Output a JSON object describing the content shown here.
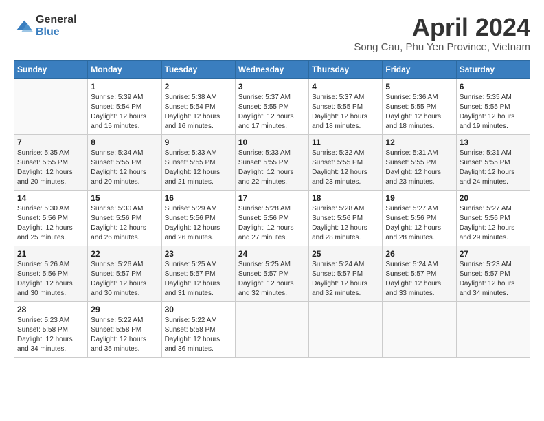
{
  "logo": {
    "general": "General",
    "blue": "Blue"
  },
  "header": {
    "title": "April 2024",
    "subtitle": "Song Cau, Phu Yen Province, Vietnam"
  },
  "calendar": {
    "days_of_week": [
      "Sunday",
      "Monday",
      "Tuesday",
      "Wednesday",
      "Thursday",
      "Friday",
      "Saturday"
    ],
    "weeks": [
      [
        {
          "day": "",
          "info": ""
        },
        {
          "day": "1",
          "info": "Sunrise: 5:39 AM\nSunset: 5:54 PM\nDaylight: 12 hours\nand 15 minutes."
        },
        {
          "day": "2",
          "info": "Sunrise: 5:38 AM\nSunset: 5:54 PM\nDaylight: 12 hours\nand 16 minutes."
        },
        {
          "day": "3",
          "info": "Sunrise: 5:37 AM\nSunset: 5:55 PM\nDaylight: 12 hours\nand 17 minutes."
        },
        {
          "day": "4",
          "info": "Sunrise: 5:37 AM\nSunset: 5:55 PM\nDaylight: 12 hours\nand 18 minutes."
        },
        {
          "day": "5",
          "info": "Sunrise: 5:36 AM\nSunset: 5:55 PM\nDaylight: 12 hours\nand 18 minutes."
        },
        {
          "day": "6",
          "info": "Sunrise: 5:35 AM\nSunset: 5:55 PM\nDaylight: 12 hours\nand 19 minutes."
        }
      ],
      [
        {
          "day": "7",
          "info": "Sunrise: 5:35 AM\nSunset: 5:55 PM\nDaylight: 12 hours\nand 20 minutes."
        },
        {
          "day": "8",
          "info": "Sunrise: 5:34 AM\nSunset: 5:55 PM\nDaylight: 12 hours\nand 20 minutes."
        },
        {
          "day": "9",
          "info": "Sunrise: 5:33 AM\nSunset: 5:55 PM\nDaylight: 12 hours\nand 21 minutes."
        },
        {
          "day": "10",
          "info": "Sunrise: 5:33 AM\nSunset: 5:55 PM\nDaylight: 12 hours\nand 22 minutes."
        },
        {
          "day": "11",
          "info": "Sunrise: 5:32 AM\nSunset: 5:55 PM\nDaylight: 12 hours\nand 23 minutes."
        },
        {
          "day": "12",
          "info": "Sunrise: 5:31 AM\nSunset: 5:55 PM\nDaylight: 12 hours\nand 23 minutes."
        },
        {
          "day": "13",
          "info": "Sunrise: 5:31 AM\nSunset: 5:55 PM\nDaylight: 12 hours\nand 24 minutes."
        }
      ],
      [
        {
          "day": "14",
          "info": "Sunrise: 5:30 AM\nSunset: 5:56 PM\nDaylight: 12 hours\nand 25 minutes."
        },
        {
          "day": "15",
          "info": "Sunrise: 5:30 AM\nSunset: 5:56 PM\nDaylight: 12 hours\nand 26 minutes."
        },
        {
          "day": "16",
          "info": "Sunrise: 5:29 AM\nSunset: 5:56 PM\nDaylight: 12 hours\nand 26 minutes."
        },
        {
          "day": "17",
          "info": "Sunrise: 5:28 AM\nSunset: 5:56 PM\nDaylight: 12 hours\nand 27 minutes."
        },
        {
          "day": "18",
          "info": "Sunrise: 5:28 AM\nSunset: 5:56 PM\nDaylight: 12 hours\nand 28 minutes."
        },
        {
          "day": "19",
          "info": "Sunrise: 5:27 AM\nSunset: 5:56 PM\nDaylight: 12 hours\nand 28 minutes."
        },
        {
          "day": "20",
          "info": "Sunrise: 5:27 AM\nSunset: 5:56 PM\nDaylight: 12 hours\nand 29 minutes."
        }
      ],
      [
        {
          "day": "21",
          "info": "Sunrise: 5:26 AM\nSunset: 5:56 PM\nDaylight: 12 hours\nand 30 minutes."
        },
        {
          "day": "22",
          "info": "Sunrise: 5:26 AM\nSunset: 5:57 PM\nDaylight: 12 hours\nand 30 minutes."
        },
        {
          "day": "23",
          "info": "Sunrise: 5:25 AM\nSunset: 5:57 PM\nDaylight: 12 hours\nand 31 minutes."
        },
        {
          "day": "24",
          "info": "Sunrise: 5:25 AM\nSunset: 5:57 PM\nDaylight: 12 hours\nand 32 minutes."
        },
        {
          "day": "25",
          "info": "Sunrise: 5:24 AM\nSunset: 5:57 PM\nDaylight: 12 hours\nand 32 minutes."
        },
        {
          "day": "26",
          "info": "Sunrise: 5:24 AM\nSunset: 5:57 PM\nDaylight: 12 hours\nand 33 minutes."
        },
        {
          "day": "27",
          "info": "Sunrise: 5:23 AM\nSunset: 5:57 PM\nDaylight: 12 hours\nand 34 minutes."
        }
      ],
      [
        {
          "day": "28",
          "info": "Sunrise: 5:23 AM\nSunset: 5:58 PM\nDaylight: 12 hours\nand 34 minutes."
        },
        {
          "day": "29",
          "info": "Sunrise: 5:22 AM\nSunset: 5:58 PM\nDaylight: 12 hours\nand 35 minutes."
        },
        {
          "day": "30",
          "info": "Sunrise: 5:22 AM\nSunset: 5:58 PM\nDaylight: 12 hours\nand 36 minutes."
        },
        {
          "day": "",
          "info": ""
        },
        {
          "day": "",
          "info": ""
        },
        {
          "day": "",
          "info": ""
        },
        {
          "day": "",
          "info": ""
        }
      ]
    ]
  }
}
